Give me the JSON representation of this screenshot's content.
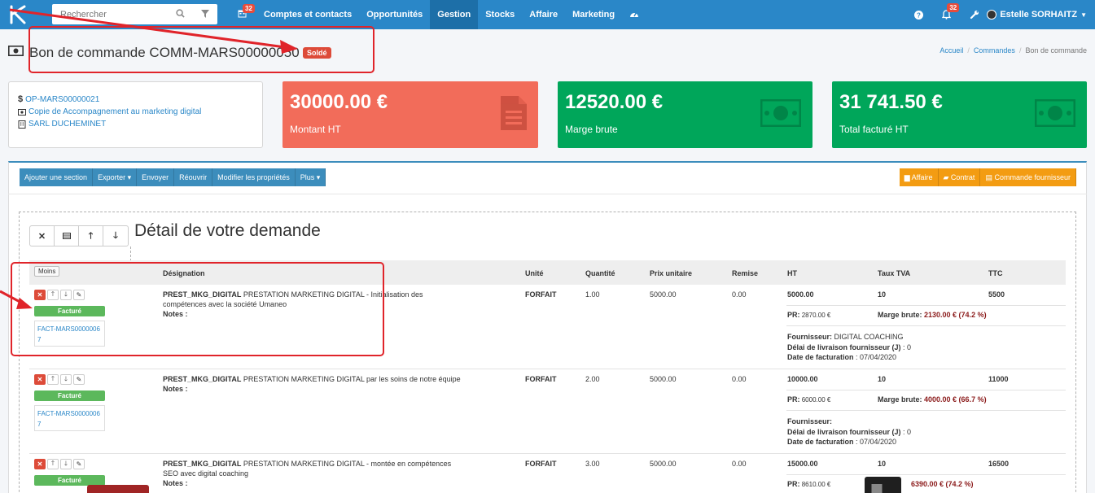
{
  "search": {
    "placeholder": "Rechercher"
  },
  "nav": {
    "calendar_badge": "32",
    "items": [
      "Comptes et contacts",
      "Opportunités",
      "Gestion",
      "Stocks",
      "Affaire",
      "Marketing"
    ]
  },
  "user": {
    "notif_badge": "32",
    "name": "Estelle SORHAITZ"
  },
  "page": {
    "title": "Bon de commande COMM-MARS00000050",
    "status": "Soldé"
  },
  "breadcrumb": [
    "Accueil",
    "Commandes",
    "Bon de commande"
  ],
  "info": {
    "opportunity": "OP-MARS00000021",
    "product": "Copie de Accompagnement au marketing digital",
    "company": "SARL DUCHEMINET"
  },
  "kpis": [
    {
      "value": "30000.00 €",
      "label": "Montant HT",
      "color": "#f26c5a",
      "icon": "document-icon"
    },
    {
      "value": "12520.00 €",
      "label": "Marge brute",
      "color": "#00a65a",
      "icon": "money-icon"
    },
    {
      "value": "31 741.50 €",
      "label": "Total facturé HT",
      "color": "#00a65a",
      "icon": "money-icon"
    }
  ],
  "toolbar": {
    "left": [
      "Ajouter une section",
      "Exporter ▾",
      "Envoyer",
      "Réouvrir",
      "Modifier les propriétés",
      "Plus ▾"
    ],
    "right": [
      "Affaire",
      "Contrat",
      "Commande fournisseur"
    ]
  },
  "section": {
    "title": "Détail de votre demande",
    "toggle": "Moins"
  },
  "table": {
    "headers": [
      "Désignation",
      "Unité",
      "Quantité",
      "Prix unitaire",
      "Remise",
      "HT",
      "Taux TVA",
      "TTC"
    ],
    "rows": [
      {
        "status": "Facturé",
        "invoice": "FACT-MARS00000067",
        "code": "PREST_MKG_DIGITAL",
        "desc": " PRESTATION MARKETING DIGITAL - Initialisation des compétences avec la société Umaneo",
        "notes": "Notes :",
        "unit": "FORFAIT",
        "qty": "1.00",
        "price": "5000.00",
        "discount": "0.00",
        "ht": "5000.00",
        "tva": "10",
        "ttc": "5500",
        "pr_label": "PR:",
        "pr": " 2870.00 €",
        "marge_label": "Marge brute:",
        "marge": " 2130.00 € (74.2 %)",
        "fournisseur_label": "Fournisseur:",
        "fournisseur": " DIGITAL COACHING",
        "delai_label": "Délai de livraison fournisseur (J)",
        "delai": " : 0",
        "date_label": "Date de facturation",
        "date": " : 07/04/2020"
      },
      {
        "status": "Facturé",
        "invoice": "FACT-MARS00000067",
        "code": "PREST_MKG_DIGITAL",
        "desc": " PRESTATION MARKETING DIGITAL par les soins de notre équipe",
        "notes": "Notes :",
        "unit": "FORFAIT",
        "qty": "2.00",
        "price": "5000.00",
        "discount": "0.00",
        "ht": "10000.00",
        "tva": "10",
        "ttc": "11000",
        "pr_label": "PR:",
        "pr": " 6000.00 €",
        "marge_label": "Marge brute:",
        "marge": " 4000.00 € (66.7 %)",
        "fournisseur_label": "Fournisseur:",
        "fournisseur": "",
        "delai_label": "Délai de livraison fournisseur (J)",
        "delai": " : 0",
        "date_label": "Date de facturation",
        "date": " : 07/04/2020"
      },
      {
        "status": "Facturé",
        "code": "PREST_MKG_DIGITAL",
        "desc": " PRESTATION MARKETING DIGITAL - montée en compétences SEO avec digital coaching",
        "notes": "Notes :",
        "unit": "FORFAIT",
        "qty": "3.00",
        "price": "5000.00",
        "discount": "0.00",
        "ht": "15000.00",
        "tva": "10",
        "ttc": "16500",
        "pr_label": "PR:",
        "pr": " 8610.00 €",
        "marge": " 6390.00 € (74.2 %)"
      }
    ]
  },
  "colors": {
    "brand": "#2a87c8",
    "active_nav": "#1d6fa8",
    "annotation": "#e0242a"
  }
}
